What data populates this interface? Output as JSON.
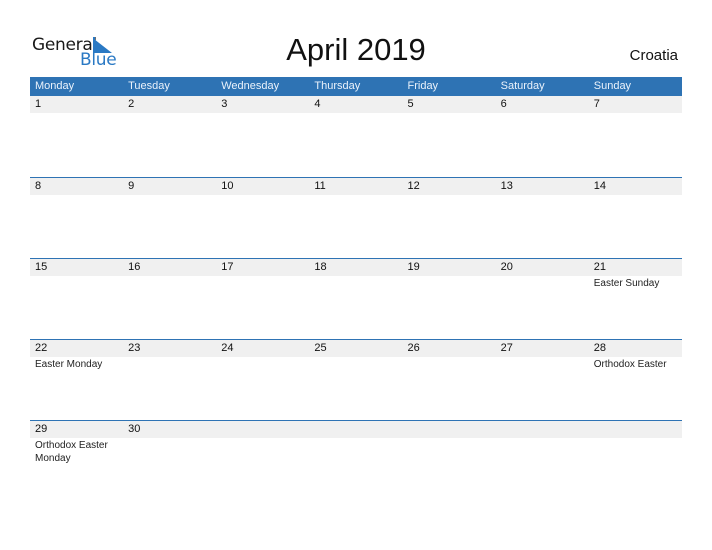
{
  "logo": {
    "line1": "General",
    "line2": "Blue"
  },
  "title": "April 2019",
  "country": "Croatia",
  "colors": {
    "accent": "#2e73b4",
    "strip": "#f0f0f0",
    "logo_blue": "#2a79c4"
  },
  "weekdays": [
    "Monday",
    "Tuesday",
    "Wednesday",
    "Thursday",
    "Friday",
    "Saturday",
    "Sunday"
  ],
  "weeks": [
    [
      {
        "day": "1",
        "event": ""
      },
      {
        "day": "2",
        "event": ""
      },
      {
        "day": "3",
        "event": ""
      },
      {
        "day": "4",
        "event": ""
      },
      {
        "day": "5",
        "event": ""
      },
      {
        "day": "6",
        "event": ""
      },
      {
        "day": "7",
        "event": ""
      }
    ],
    [
      {
        "day": "8",
        "event": ""
      },
      {
        "day": "9",
        "event": ""
      },
      {
        "day": "10",
        "event": ""
      },
      {
        "day": "11",
        "event": ""
      },
      {
        "day": "12",
        "event": ""
      },
      {
        "day": "13",
        "event": ""
      },
      {
        "day": "14",
        "event": ""
      }
    ],
    [
      {
        "day": "15",
        "event": ""
      },
      {
        "day": "16",
        "event": ""
      },
      {
        "day": "17",
        "event": ""
      },
      {
        "day": "18",
        "event": ""
      },
      {
        "day": "19",
        "event": ""
      },
      {
        "day": "20",
        "event": ""
      },
      {
        "day": "21",
        "event": "Easter Sunday"
      }
    ],
    [
      {
        "day": "22",
        "event": "Easter Monday"
      },
      {
        "day": "23",
        "event": ""
      },
      {
        "day": "24",
        "event": ""
      },
      {
        "day": "25",
        "event": ""
      },
      {
        "day": "26",
        "event": ""
      },
      {
        "day": "27",
        "event": ""
      },
      {
        "day": "28",
        "event": "Orthodox Easter"
      }
    ],
    [
      {
        "day": "29",
        "event": "Orthodox Easter Monday"
      },
      {
        "day": "30",
        "event": ""
      },
      {
        "day": "",
        "event": ""
      },
      {
        "day": "",
        "event": ""
      },
      {
        "day": "",
        "event": ""
      },
      {
        "day": "",
        "event": ""
      },
      {
        "day": "",
        "event": ""
      }
    ]
  ]
}
